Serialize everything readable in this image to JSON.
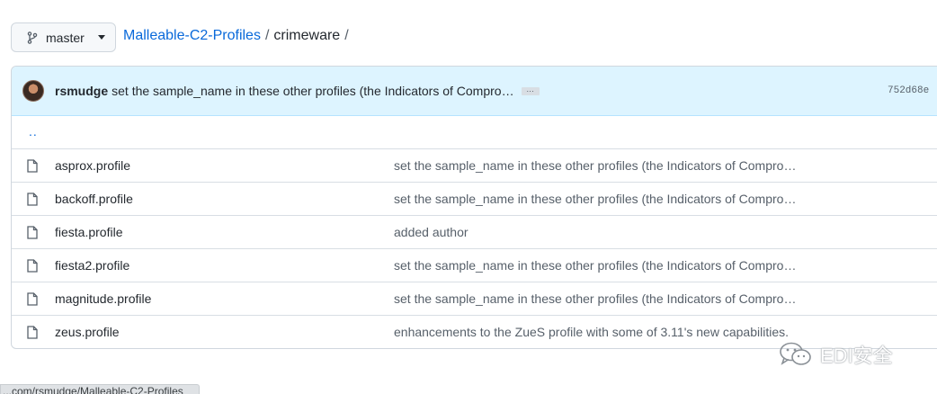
{
  "branch": {
    "label": "master",
    "icon": "git-branch-icon"
  },
  "breadcrumb": {
    "repo": "Malleable-C2-Profiles",
    "sep1": "/",
    "folder": "crimeware",
    "sep2": "/"
  },
  "latest_commit": {
    "author": "rsmudge",
    "message": "set the sample_name in these other profiles (the Indicators of Compro…",
    "ellipsis": "…",
    "sha": "752d68e"
  },
  "parent_dir": "..",
  "files": [
    {
      "name": "asprox.profile",
      "message": "set the sample_name in these other profiles (the Indicators of Compro…"
    },
    {
      "name": "backoff.profile",
      "message": "set the sample_name in these other profiles (the Indicators of Compro…"
    },
    {
      "name": "fiesta.profile",
      "message": "added author"
    },
    {
      "name": "fiesta2.profile",
      "message": "set the sample_name in these other profiles (the Indicators of Compro…"
    },
    {
      "name": "magnitude.profile",
      "message": "set the sample_name in these other profiles (the Indicators of Compro…"
    },
    {
      "name": "zeus.profile",
      "message": "enhancements to the ZueS profile with some of 3.11's new capabilities."
    }
  ],
  "watermark": {
    "text": "EDI安全",
    "icon": "wechat-icon"
  },
  "status_url": "...com/rsmudge/Malleable-C2-Profiles",
  "colors": {
    "link": "#0969da",
    "commit_bar": "#ddf4ff",
    "border": "#d0d7de"
  }
}
